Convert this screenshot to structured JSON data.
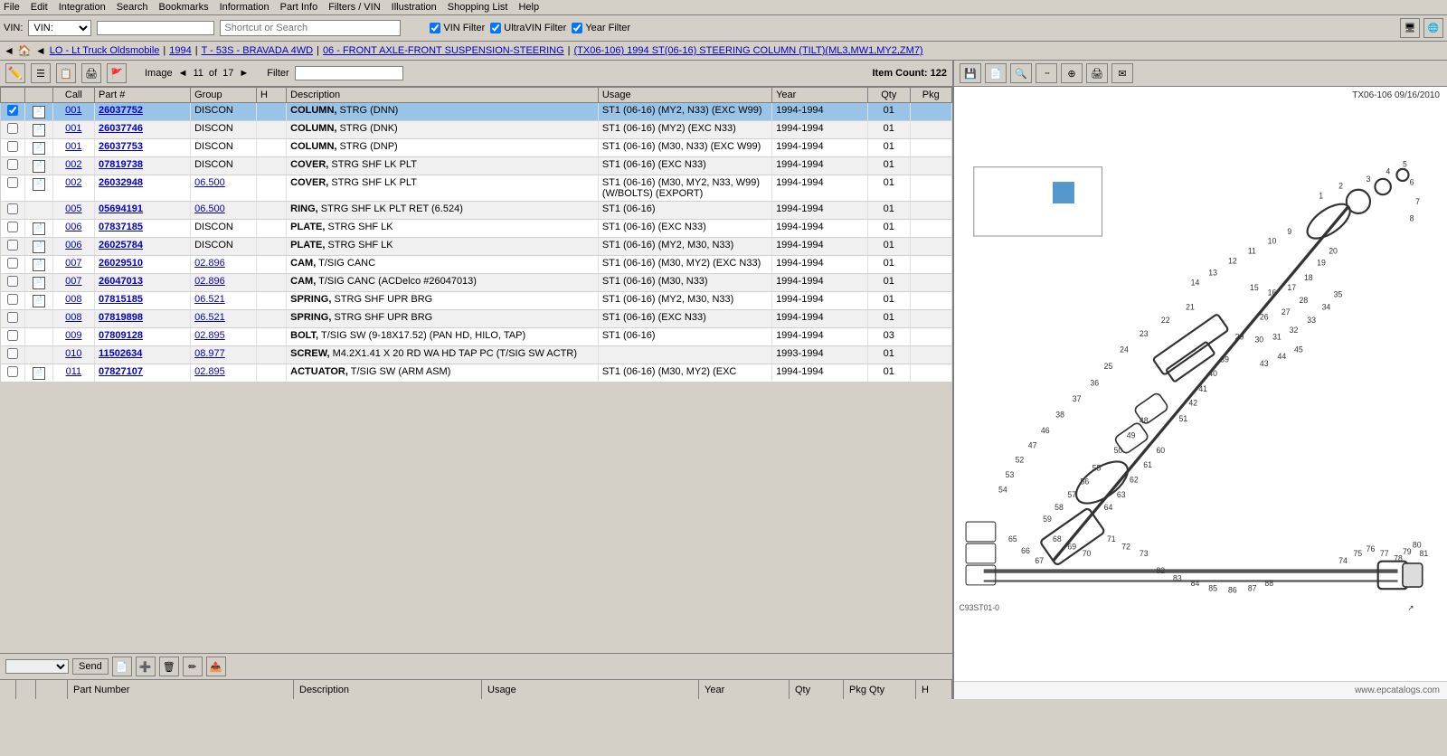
{
  "menu": {
    "items": [
      "File",
      "Edit",
      "Integration",
      "Search",
      "Bookmarks",
      "Information",
      "Part Info",
      "Filters / VIN",
      "Illustration",
      "Shopping List",
      "Help"
    ]
  },
  "toolbar": {
    "vin_label": "VIN:",
    "vin_options": [
      "VIN:"
    ],
    "vin_value": "",
    "search_placeholder": "Shortcut or Search",
    "filters": {
      "vin_filter": "VIN Filter",
      "ultra_vin": "UltraVIN Filter",
      "year_filter": "Year Filter"
    }
  },
  "breadcrumb": {
    "items": [
      "LO - Lt Truck Oldsmobile",
      "1994",
      "T - 53S - BRAVADA 4WD",
      "06 - FRONT AXLE-FRONT SUSPENSION-STEERING",
      "(TX06-106)  1994  ST(06-16) STEERING COLUMN (TILT)(ML3,MW1,MY2,ZM7)"
    ]
  },
  "image_toolbar": {
    "image_label": "Image",
    "prev": "◄",
    "next": "►",
    "page": "11",
    "total": "17",
    "filter_label": "Filter",
    "item_count": "Item Count: 122"
  },
  "table": {
    "columns": [
      "",
      "",
      "Call",
      "Part #",
      "Group",
      "H",
      "Description",
      "Usage",
      "Year",
      "Qty",
      "Pkg"
    ],
    "rows": [
      {
        "selected": true,
        "has_icon": true,
        "call": "001",
        "part": "26037752",
        "group": "DISCON",
        "h": "",
        "desc_bold": "COLUMN,",
        "desc_rest": " STRG (DNN)",
        "usage": "ST1  (06-16) (MY2, N33) (EXC W99)",
        "year": "1994-1994",
        "qty": "01",
        "pkg": ""
      },
      {
        "selected": false,
        "has_icon": true,
        "call": "001",
        "part": "26037746",
        "group": "DISCON",
        "h": "",
        "desc_bold": "COLUMN,",
        "desc_rest": " STRG (DNK)",
        "usage": "ST1  (06-16) (MY2) (EXC N33)",
        "year": "1994-1994",
        "qty": "01",
        "pkg": ""
      },
      {
        "selected": false,
        "has_icon": true,
        "call": "001",
        "part": "26037753",
        "group": "DISCON",
        "h": "",
        "desc_bold": "COLUMN,",
        "desc_rest": " STRG (DNP)",
        "usage": "ST1  (06-16) (M30, N33) (EXC W99)",
        "year": "1994-1994",
        "qty": "01",
        "pkg": ""
      },
      {
        "selected": false,
        "has_icon": true,
        "call": "002",
        "part": "07819738",
        "group": "DISCON",
        "h": "",
        "desc_bold": "COVER,",
        "desc_rest": " STRG SHF LK PLT",
        "usage": "ST1  (06-16) (EXC N33)",
        "year": "1994-1994",
        "qty": "01",
        "pkg": ""
      },
      {
        "selected": false,
        "has_icon": true,
        "call": "002",
        "part": "26032948",
        "group": "06.500",
        "h": "",
        "desc_bold": "COVER,",
        "desc_rest": " STRG SHF LK PLT",
        "usage": "ST1  (06-16) (M30, MY2, N33, W99) (W/BOLTS) (EXPORT)",
        "year": "1994-1994",
        "qty": "01",
        "pkg": ""
      },
      {
        "selected": false,
        "has_icon": false,
        "call": "005",
        "part": "05694191",
        "group": "06.500",
        "h": "",
        "desc_bold": "RING,",
        "desc_rest": " STRG SHF LK PLT RET (6.524)",
        "usage": "ST1  (06-16)",
        "year": "1994-1994",
        "qty": "01",
        "pkg": ""
      },
      {
        "selected": false,
        "has_icon": true,
        "call": "006",
        "part": "07837185",
        "group": "DISCON",
        "h": "",
        "desc_bold": "PLATE,",
        "desc_rest": " STRG SHF LK",
        "usage": "ST1  (06-16) (EXC N33)",
        "year": "1994-1994",
        "qty": "01",
        "pkg": ""
      },
      {
        "selected": false,
        "has_icon": true,
        "call": "006",
        "part": "26025784",
        "group": "DISCON",
        "h": "",
        "desc_bold": "PLATE,",
        "desc_rest": " STRG SHF LK",
        "usage": "ST1  (06-16) (MY2, M30, N33)",
        "year": "1994-1994",
        "qty": "01",
        "pkg": ""
      },
      {
        "selected": false,
        "has_icon": true,
        "call": "007",
        "part": "26029510",
        "group": "02.896",
        "h": "",
        "desc_bold": "CAM,",
        "desc_rest": " T/SIG CANC",
        "usage": "ST1  (06-16) (M30, MY2) (EXC N33)",
        "year": "1994-1994",
        "qty": "01",
        "pkg": ""
      },
      {
        "selected": false,
        "has_icon": true,
        "call": "007",
        "part": "26047013",
        "group": "02.896",
        "h": "",
        "desc_bold": "CAM,",
        "desc_rest": " T/SIG CANC (ACDelco #26047013)",
        "usage": "ST1  (06-16) (M30, N33)",
        "year": "1994-1994",
        "qty": "01",
        "pkg": ""
      },
      {
        "selected": false,
        "has_icon": true,
        "call": "008",
        "part": "07815185",
        "group": "06.521",
        "h": "",
        "desc_bold": "SPRING,",
        "desc_rest": " STRG SHF UPR BRG",
        "usage": "ST1  (06-16) (MY2, M30, N33)",
        "year": "1994-1994",
        "qty": "01",
        "pkg": ""
      },
      {
        "selected": false,
        "has_icon": false,
        "call": "008",
        "part": "07819898",
        "group": "06.521",
        "h": "",
        "desc_bold": "SPRING,",
        "desc_rest": " STRG SHF UPR BRG",
        "usage": "ST1  (06-16) (EXC N33)",
        "year": "1994-1994",
        "qty": "01",
        "pkg": ""
      },
      {
        "selected": false,
        "has_icon": false,
        "call": "009",
        "part": "07809128",
        "group": "02.895",
        "h": "",
        "desc_bold": "BOLT,",
        "desc_rest": " T/SIG SW (9-18X17.52) (PAN HD, HILO, TAP)",
        "usage": "ST1  (06-16)",
        "year": "1994-1994",
        "qty": "03",
        "pkg": ""
      },
      {
        "selected": false,
        "has_icon": false,
        "call": "010",
        "part": "11502634",
        "group": "08.977",
        "h": "",
        "desc_bold": "SCREW,",
        "desc_rest": " M4.2X1.41 X 20 RD WA HD TAP PC (T/SIG SW ACTR)",
        "usage": "",
        "year": "1993-1994",
        "qty": "01",
        "pkg": ""
      },
      {
        "selected": false,
        "has_icon": true,
        "call": "011",
        "part": "07827107",
        "group": "02.895",
        "h": "",
        "desc_bold": "ACTUATOR,",
        "desc_rest": " T/SIG SW (ARM ASM)",
        "usage": "ST1  (06-16) (M30, MY2) (EXC",
        "year": "1994-1994",
        "qty": "01",
        "pkg": ""
      }
    ]
  },
  "bottom_toolbar": {
    "send_label": "Send",
    "icons": [
      "copy",
      "add",
      "delete",
      "edit",
      "export"
    ]
  },
  "status_bar": {
    "part_number": "Part Number",
    "description": "Description",
    "usage": "Usage",
    "year": "Year",
    "qty": "Qty",
    "pkg_qty": "Pkg Qty",
    "h": "H"
  },
  "diagram": {
    "label": "TX06-106  09/16/2010",
    "watermark": "www.epcatalogs.com"
  },
  "right_toolbar_icons": [
    "save",
    "document",
    "search",
    "dotted-line",
    "zoom",
    "print",
    "mail"
  ]
}
